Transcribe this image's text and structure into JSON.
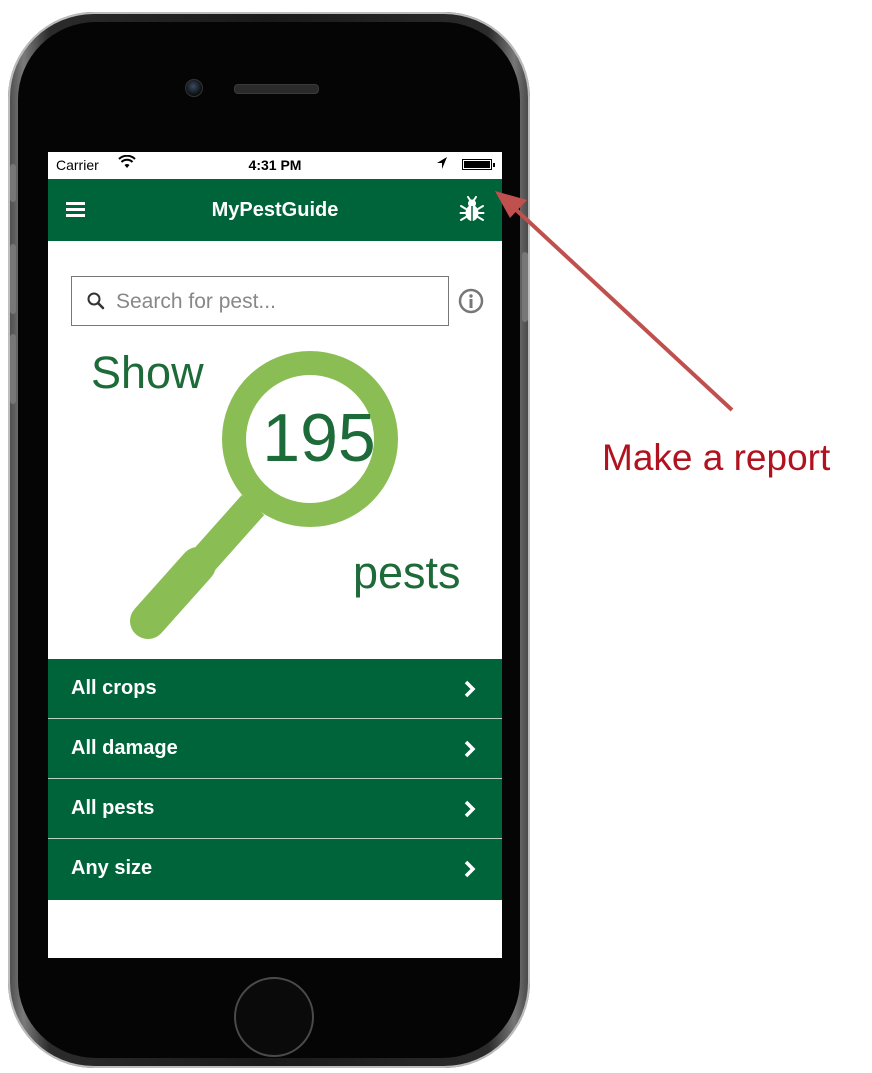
{
  "status_bar": {
    "carrier": "Carrier",
    "time": "4:31 PM"
  },
  "nav": {
    "title": "MyPestGuide",
    "menu_icon": "hamburger-menu-icon",
    "report_icon": "bug-icon"
  },
  "search": {
    "placeholder": "Search for pest...",
    "value": ""
  },
  "hero": {
    "prefix": "Show",
    "count": "195",
    "suffix": "pests"
  },
  "filters": [
    {
      "label": "All crops"
    },
    {
      "label": "All damage"
    },
    {
      "label": "All pests"
    },
    {
      "label": "Any size"
    }
  ],
  "annotation": {
    "text": "Make a report"
  },
  "colors": {
    "brand_green": "#00643b",
    "light_green": "#8bbd55",
    "text_green": "#1e6b3a",
    "annotation_red": "#b0121f"
  }
}
